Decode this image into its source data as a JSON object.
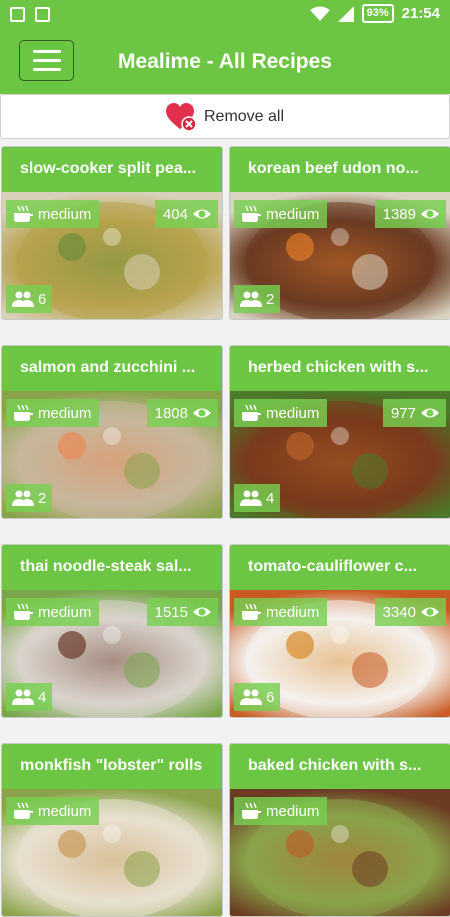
{
  "status_bar": {
    "battery": "93%",
    "time": "21:54"
  },
  "app_bar": {
    "title": "Mealime - All Recipes"
  },
  "remove_all": {
    "label": "Remove all"
  },
  "recipes": [
    {
      "title": "slow-cooker split pea...",
      "difficulty": "medium",
      "views": "404",
      "servings": "6",
      "image": [
        "#b7a24d",
        "#6e8d3a",
        "#d8d0b8"
      ]
    },
    {
      "title": "korean beef udon no...",
      "difficulty": "medium",
      "views": "1389",
      "servings": "2",
      "image": [
        "#6b3b22",
        "#e07b2a",
        "#d9d3c2"
      ]
    },
    {
      "title": "salmon and zucchini ...",
      "difficulty": "medium",
      "views": "1808",
      "servings": "2",
      "image": [
        "#c7b79c",
        "#e88a55",
        "#8aa34a"
      ]
    },
    {
      "title": "herbed chicken with s...",
      "difficulty": "medium",
      "views": "977",
      "servings": "4",
      "image": [
        "#7a3a1c",
        "#b8632a",
        "#4a7a2a"
      ]
    },
    {
      "title": "thai noodle-steak sal...",
      "difficulty": "medium",
      "views": "1515",
      "servings": "4",
      "image": [
        "#d9d4cc",
        "#6b3a2b",
        "#7aa64a"
      ]
    },
    {
      "title": "tomato-cauliflower c...",
      "difficulty": "medium",
      "views": "3340",
      "servings": "6",
      "image": [
        "#f4f1ec",
        "#d98a2a",
        "#c85a22"
      ]
    },
    {
      "title": "monkfish \"lobster\" rolls",
      "difficulty": "medium",
      "views": "",
      "servings": "",
      "image": [
        "#e8e0d0",
        "#c99a5a",
        "#8aa34a"
      ]
    },
    {
      "title": "baked chicken with s...",
      "difficulty": "medium",
      "views": "",
      "servings": "",
      "image": [
        "#8aa34a",
        "#b8632a",
        "#6b3b22"
      ]
    }
  ],
  "icons": {
    "menu": "hamburger-icon",
    "remove": "broken-heart-icon",
    "difficulty": "cooking-pot-icon",
    "views": "eye-icon",
    "servings": "people-icon"
  },
  "colors": {
    "primary": "#6cc644",
    "chip": "#78d050"
  }
}
